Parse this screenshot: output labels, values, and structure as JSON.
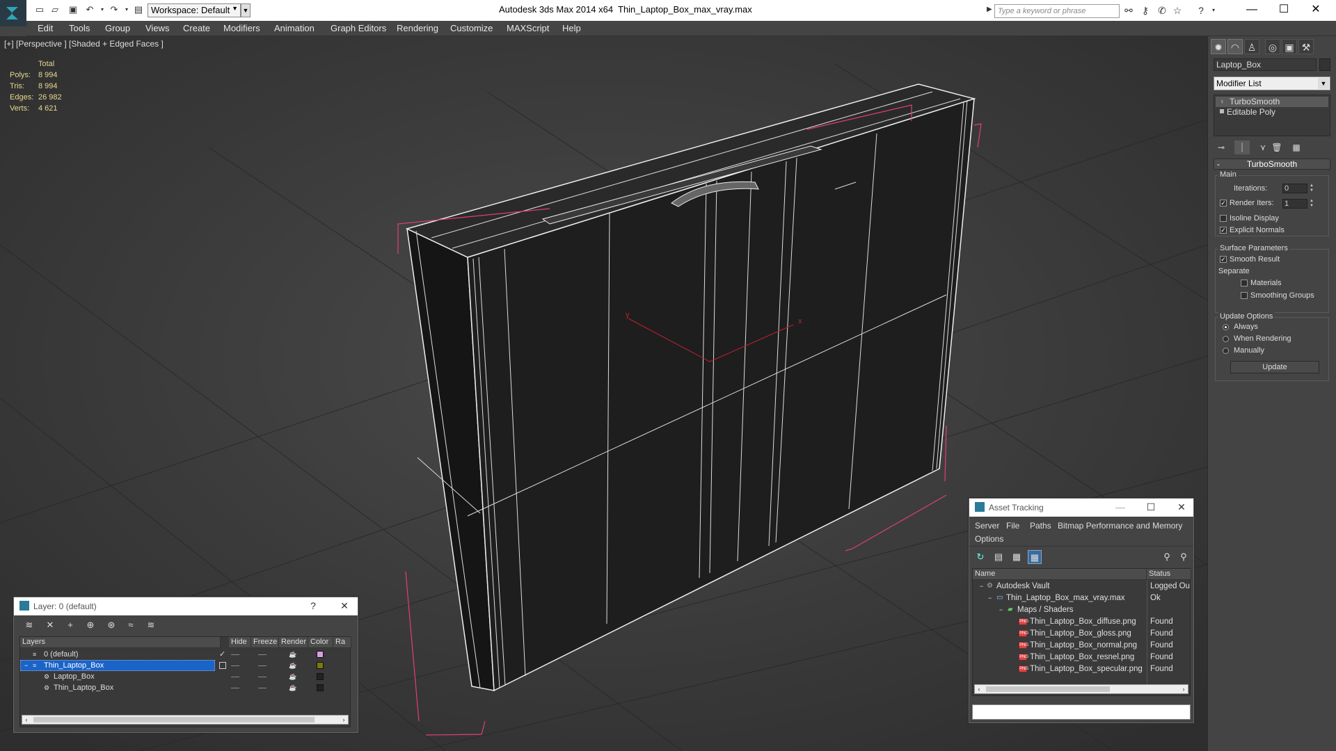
{
  "app": {
    "title": "Autodesk 3ds Max  2014 x64",
    "file": "Thin_Laptop_Box_max_vray.max",
    "workspace": "Workspace: Default",
    "search_placeholder": "Type a keyword or phrase"
  },
  "menu": [
    "Edit",
    "Tools",
    "Group",
    "Views",
    "Create",
    "Modifiers",
    "Animation",
    "Graph Editors",
    "Rendering",
    "Customize",
    "MAXScript",
    "Help"
  ],
  "viewport": {
    "label": "[+] [Perspective ] [Shaded + Edged Faces ]",
    "stats": {
      "header": "Total",
      "polys_label": "Polys:",
      "polys": "8 994",
      "tris_label": "Tris:",
      "tris": "8 994",
      "edges_label": "Edges:",
      "edges": "26 982",
      "verts_label": "Verts:",
      "verts": "4 621"
    },
    "axis_x": "x",
    "axis_y": "y"
  },
  "command_panel": {
    "object_name": "Laptop_Box",
    "modifier_list": "Modifier List",
    "stack": [
      "TurboSmooth",
      "Editable Poly"
    ],
    "rollout": "TurboSmooth",
    "main_group": "Main",
    "iterations_label": "Iterations:",
    "iterations": "0",
    "render_iters_label": "Render Iters:",
    "render_iters": "1",
    "isoline": "Isoline Display",
    "explicit_normals": "Explicit Normals",
    "surface_group": "Surface Parameters",
    "smooth_result": "Smooth Result",
    "separate": "Separate",
    "materials": "Materials",
    "smoothing_groups": "Smoothing Groups",
    "update_group": "Update Options",
    "always": "Always",
    "when_rendering": "When Rendering",
    "manually": "Manually",
    "update_button": "Update"
  },
  "layer_dialog": {
    "title": "Layer: 0 (default)",
    "help": "?",
    "columns": [
      "Layers",
      "Hide",
      "Freeze",
      "Render",
      "Color",
      "Ra"
    ],
    "rows": [
      {
        "name": "0 (default)",
        "color": "#d8a0e0"
      },
      {
        "name": "Thin_Laptop_Box",
        "color": "#7a7a10"
      },
      {
        "name": "Laptop_Box",
        "color": "#222222"
      },
      {
        "name": "Thin_Laptop_Box",
        "color": "#222222"
      }
    ]
  },
  "asset_tracking": {
    "title": "Asset Tracking",
    "menu": [
      "Server",
      "File",
      "Paths",
      "Bitmap Performance and Memory",
      "Options"
    ],
    "col_name": "Name",
    "col_status": "Status",
    "rows": [
      {
        "name": "Autodesk Vault",
        "status": "Logged Ou"
      },
      {
        "name": "Thin_Laptop_Box_max_vray.max",
        "status": "Ok"
      },
      {
        "name": "Maps / Shaders",
        "status": ""
      },
      {
        "name": "Thin_Laptop_Box_diffuse.png",
        "status": "Found"
      },
      {
        "name": "Thin_Laptop_Box_gloss.png",
        "status": "Found"
      },
      {
        "name": "Thin_Laptop_Box_normal.png",
        "status": "Found"
      },
      {
        "name": "Thin_Laptop_Box_resnel.png",
        "status": "Found"
      },
      {
        "name": "Thin_Laptop_Box_specular.png",
        "status": "Found"
      }
    ]
  },
  "colors": {
    "stats_text": "#e8d890",
    "selection": "#1a64c8",
    "bbox": "#e04070"
  }
}
